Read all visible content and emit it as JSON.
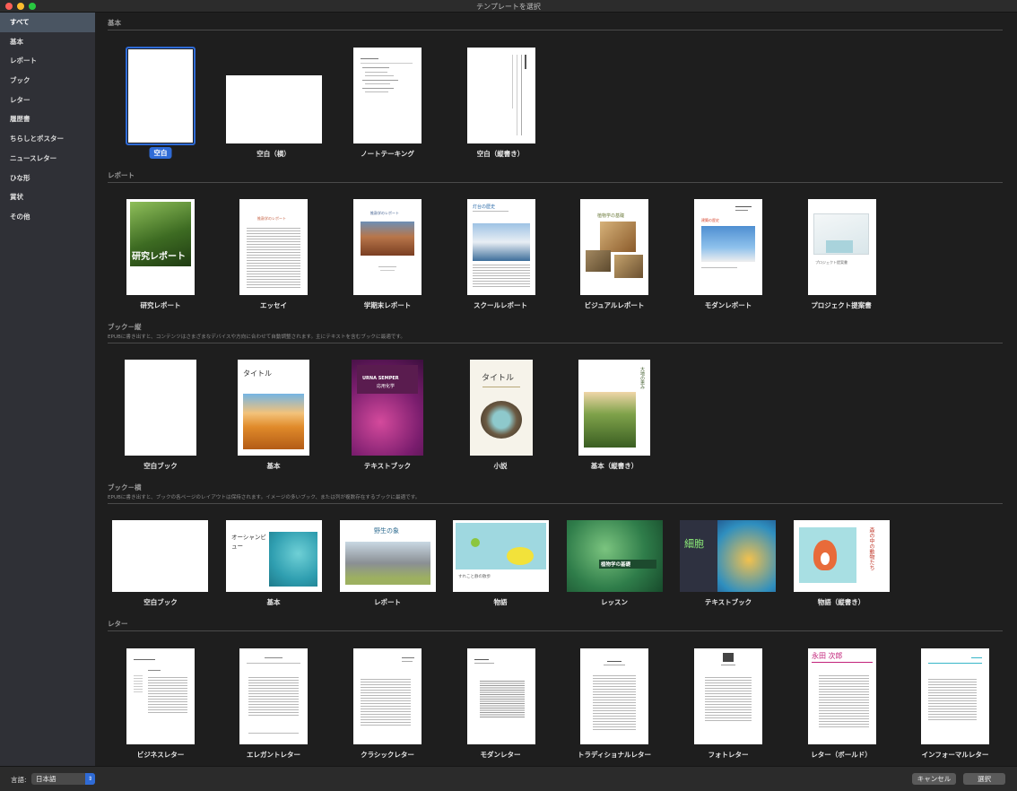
{
  "window": {
    "title": "テンプレートを選択"
  },
  "sidebar": {
    "items": [
      {
        "label": "すべて"
      },
      {
        "label": "基本"
      },
      {
        "label": "レポート"
      },
      {
        "label": "ブック"
      },
      {
        "label": "レター"
      },
      {
        "label": "履歴書"
      },
      {
        "label": "ちらしとポスター"
      },
      {
        "label": "ニュースレター"
      },
      {
        "label": "ひな形"
      },
      {
        "label": "賞状"
      },
      {
        "label": "その他"
      }
    ],
    "selected": "すべて"
  },
  "sections": {
    "basic": {
      "title": "基本",
      "templates": [
        {
          "label": "空白",
          "selected": true
        },
        {
          "label": "空白（横）"
        },
        {
          "label": "ノートテーキング"
        },
        {
          "label": "空白（縦書き）"
        }
      ]
    },
    "report": {
      "title": "レポート",
      "templates": [
        {
          "label": "研究レポート",
          "thumb_text": "研究レポート"
        },
        {
          "label": "エッセイ",
          "thumb_text": "推敲学のレポート"
        },
        {
          "label": "学期末レポート",
          "thumb_text": "推敲学のレポート"
        },
        {
          "label": "スクールレポート",
          "thumb_text": "灯台の歴史"
        },
        {
          "label": "ビジュアルレポート",
          "thumb_text": "植物学の基礎"
        },
        {
          "label": "モダンレポート",
          "thumb_text": "建築の歴史"
        },
        {
          "label": "プロジェクト提案書",
          "thumb_text": "プロジェクト提案書"
        }
      ]
    },
    "book_portrait": {
      "title": "ブック－縦",
      "subtitle": "EPUBに書き出すと、コンテンツはさまざまなデバイスや方向に合わせて自動調整されます。主にテキストを含むブックに最適です。",
      "templates": [
        {
          "label": "空白ブック"
        },
        {
          "label": "基本",
          "thumb_text": "タイトル"
        },
        {
          "label": "テキストブック",
          "thumb_text": "URNA SEMPER",
          "thumb_sub": "応用化学"
        },
        {
          "label": "小説",
          "thumb_text": "タイトル"
        },
        {
          "label": "基本（縦書き）",
          "thumb_text": "大地の恵み"
        }
      ]
    },
    "book_landscape": {
      "title": "ブック－横",
      "subtitle": "EPUBに書き出すと、ブックの各ページのレイアウトは保持されます。イメージの多いブック、または列が複数存在するブックに最適です。",
      "templates": [
        {
          "label": "空白ブック"
        },
        {
          "label": "基本",
          "thumb_text": "オーシャンビュー"
        },
        {
          "label": "レポート",
          "thumb_text": "野生の象"
        },
        {
          "label": "物語",
          "thumb_text": "すれこと静の散歩"
        },
        {
          "label": "レッスン",
          "thumb_text": "植物学の基礎"
        },
        {
          "label": "テキストブック",
          "thumb_text": "細胞"
        },
        {
          "label": "物語（縦書き）",
          "thumb_text": "森の中の動物たち"
        }
      ]
    },
    "letter": {
      "title": "レター",
      "templates": [
        {
          "label": "ビジネスレター"
        },
        {
          "label": "エレガントレター"
        },
        {
          "label": "クラシックレター"
        },
        {
          "label": "モダンレター"
        },
        {
          "label": "トラディショナルレター"
        },
        {
          "label": "フォトレター"
        },
        {
          "label": "レター（ボールド）",
          "thumb_text": "永田 次郎"
        },
        {
          "label": "インフォーマルレター"
        }
      ]
    }
  },
  "footer": {
    "language_label": "言語:",
    "language_value": "日本語",
    "cancel_label": "キャンセル",
    "choose_label": "選択"
  },
  "colors": {
    "accent": "#2f6bd6",
    "sidebar_selected": "#4a5562"
  }
}
